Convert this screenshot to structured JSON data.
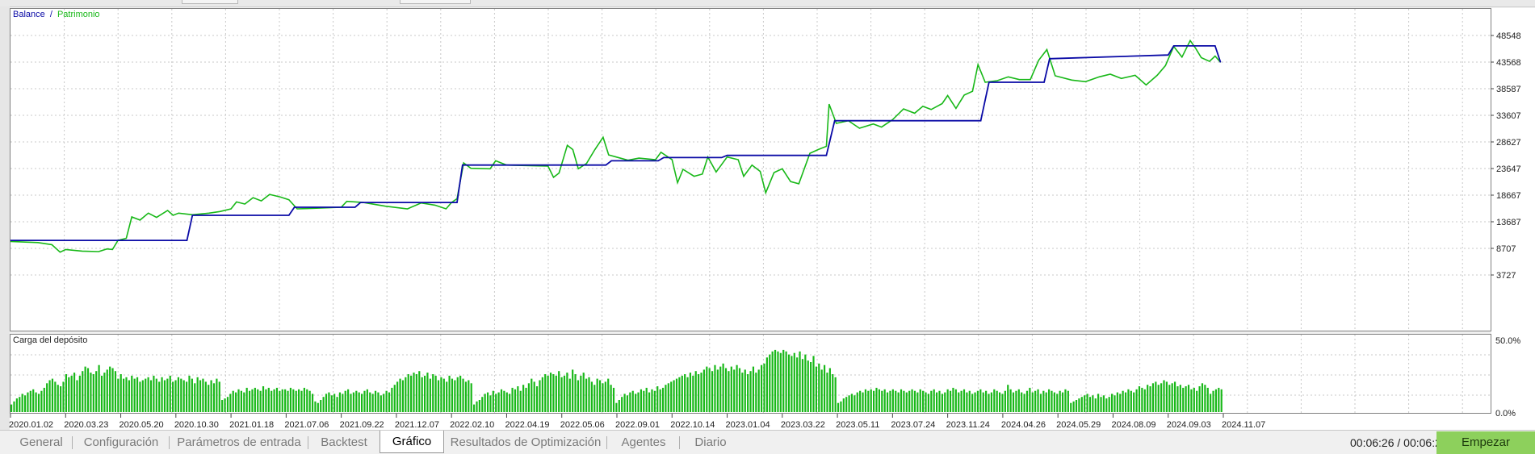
{
  "chart": {
    "legend": {
      "balance": "Balance",
      "separator": "/",
      "equity": "Patrimonio"
    },
    "subchart_label": "Carga del depósito",
    "y_ticks": [
      "48548",
      "43568",
      "38587",
      "33607",
      "28627",
      "23647",
      "18667",
      "13687",
      "8707",
      "3727"
    ],
    "sub_y_ticks": [
      "50.0%",
      "0.0%"
    ],
    "x_ticks": [
      "2020.01.02",
      "2020.03.23",
      "2020.05.20",
      "2020.10.30",
      "2021.01.18",
      "2021.07.06",
      "2021.09.22",
      "2021.12.07",
      "2022.02.10",
      "2022.04.19",
      "2022.05.06",
      "2022.09.01",
      "2022.10.14",
      "2023.01.04",
      "2023.03.22",
      "2023.05.11",
      "2023.07.24",
      "2023.11.24",
      "2024.04.26",
      "2024.05.29",
      "2024.08.09",
      "2024.09.03",
      "2024.11.07"
    ],
    "colors": {
      "balance": "#0a0aa6",
      "equity": "#18b818",
      "load": "#18b818",
      "grid": "#c8c8c8"
    }
  },
  "chart_data": {
    "type": "line",
    "xlabel": "",
    "ylabel": "",
    "ylim": [
      3727,
      50200
    ],
    "grid": true,
    "legend_placement": "top-left",
    "x_tick_index": [
      0,
      100,
      200,
      300,
      400,
      500,
      600,
      700,
      800,
      900,
      1000,
      1100,
      1200,
      1300,
      1400,
      1500,
      1600,
      1700,
      1800,
      1900,
      2000,
      2100,
      2200
    ],
    "series": [
      {
        "name": "Balance",
        "points": [
          [
            0,
            10200
          ],
          [
            320,
            10200
          ],
          [
            330,
            14900
          ],
          [
            505,
            14900
          ],
          [
            515,
            16400
          ],
          [
            625,
            16400
          ],
          [
            635,
            17300
          ],
          [
            810,
            17300
          ],
          [
            820,
            24300
          ],
          [
            1080,
            24300
          ],
          [
            1090,
            25100
          ],
          [
            1175,
            25100
          ],
          [
            1185,
            25700
          ],
          [
            1290,
            25700
          ],
          [
            1300,
            26100
          ],
          [
            1480,
            26100
          ],
          [
            1495,
            32600
          ],
          [
            1760,
            32600
          ],
          [
            1775,
            39800
          ],
          [
            1875,
            39800
          ],
          [
            1885,
            44200
          ],
          [
            2100,
            44900
          ],
          [
            2110,
            46600
          ],
          [
            2185,
            46600
          ],
          [
            2195,
            43500
          ]
        ]
      },
      {
        "name": "Patrimonio",
        "points": [
          [
            0,
            10000
          ],
          [
            50,
            9800
          ],
          [
            75,
            9400
          ],
          [
            90,
            8000
          ],
          [
            100,
            8500
          ],
          [
            130,
            8200
          ],
          [
            160,
            8100
          ],
          [
            175,
            8600
          ],
          [
            185,
            8500
          ],
          [
            195,
            10200
          ],
          [
            210,
            10600
          ],
          [
            220,
            14600
          ],
          [
            235,
            14000
          ],
          [
            250,
            15300
          ],
          [
            265,
            14500
          ],
          [
            285,
            15800
          ],
          [
            295,
            14900
          ],
          [
            305,
            15300
          ],
          [
            330,
            15000
          ],
          [
            360,
            15300
          ],
          [
            380,
            15600
          ],
          [
            400,
            16100
          ],
          [
            410,
            17400
          ],
          [
            425,
            17000
          ],
          [
            440,
            18200
          ],
          [
            455,
            17600
          ],
          [
            470,
            18800
          ],
          [
            490,
            18300
          ],
          [
            505,
            17800
          ],
          [
            520,
            16100
          ],
          [
            550,
            16200
          ],
          [
            600,
            16400
          ],
          [
            610,
            17500
          ],
          [
            640,
            17300
          ],
          [
            680,
            16600
          ],
          [
            720,
            16100
          ],
          [
            745,
            17200
          ],
          [
            770,
            16800
          ],
          [
            790,
            16100
          ],
          [
            800,
            17300
          ],
          [
            810,
            18000
          ],
          [
            822,
            24700
          ],
          [
            835,
            23700
          ],
          [
            870,
            23600
          ],
          [
            880,
            25100
          ],
          [
            900,
            24300
          ],
          [
            935,
            24200
          ],
          [
            975,
            24100
          ],
          [
            985,
            22000
          ],
          [
            995,
            22800
          ],
          [
            1010,
            28000
          ],
          [
            1020,
            27200
          ],
          [
            1030,
            23600
          ],
          [
            1045,
            24600
          ],
          [
            1060,
            27200
          ],
          [
            1075,
            29500
          ],
          [
            1085,
            26200
          ],
          [
            1120,
            25200
          ],
          [
            1140,
            25600
          ],
          [
            1170,
            25300
          ],
          [
            1180,
            26700
          ],
          [
            1200,
            25300
          ],
          [
            1210,
            21000
          ],
          [
            1220,
            23500
          ],
          [
            1240,
            22200
          ],
          [
            1255,
            22600
          ],
          [
            1265,
            25800
          ],
          [
            1280,
            23000
          ],
          [
            1300,
            25800
          ],
          [
            1320,
            25300
          ],
          [
            1330,
            22200
          ],
          [
            1345,
            24300
          ],
          [
            1360,
            23100
          ],
          [
            1370,
            19100
          ],
          [
            1385,
            22900
          ],
          [
            1400,
            23600
          ],
          [
            1415,
            21200
          ],
          [
            1430,
            20800
          ],
          [
            1450,
            26500
          ],
          [
            1465,
            27200
          ],
          [
            1480,
            27800
          ],
          [
            1485,
            35700
          ],
          [
            1498,
            32100
          ],
          [
            1520,
            32600
          ],
          [
            1540,
            31200
          ],
          [
            1565,
            32000
          ],
          [
            1580,
            31400
          ],
          [
            1600,
            32800
          ],
          [
            1620,
            34800
          ],
          [
            1640,
            34000
          ],
          [
            1655,
            35300
          ],
          [
            1670,
            34700
          ],
          [
            1690,
            35800
          ],
          [
            1700,
            37300
          ],
          [
            1715,
            34900
          ],
          [
            1730,
            37400
          ],
          [
            1745,
            38100
          ],
          [
            1755,
            43100
          ],
          [
            1768,
            39800
          ],
          [
            1790,
            40100
          ],
          [
            1810,
            40800
          ],
          [
            1830,
            40300
          ],
          [
            1850,
            40300
          ],
          [
            1865,
            43900
          ],
          [
            1880,
            45900
          ],
          [
            1895,
            41000
          ],
          [
            1925,
            40200
          ],
          [
            1950,
            39900
          ],
          [
            1975,
            40800
          ],
          [
            1995,
            41300
          ],
          [
            2015,
            40500
          ],
          [
            2040,
            41100
          ],
          [
            2060,
            39300
          ],
          [
            2080,
            41100
          ],
          [
            2095,
            42900
          ],
          [
            2110,
            46500
          ],
          [
            2125,
            44500
          ],
          [
            2140,
            47600
          ],
          [
            2150,
            46100
          ],
          [
            2160,
            44400
          ],
          [
            2175,
            43700
          ],
          [
            2185,
            44700
          ],
          [
            2195,
            43500
          ]
        ]
      }
    ],
    "subchart": {
      "type": "bar",
      "name": "Carga del depósito",
      "ylim": [
        0,
        50
      ],
      "values": [
        5,
        7,
        9,
        10,
        12,
        11,
        13,
        14,
        15,
        13,
        12,
        14,
        16,
        19,
        21,
        22,
        20,
        18,
        17,
        20,
        25,
        23,
        24,
        26,
        21,
        24,
        27,
        30,
        29,
        26,
        25,
        27,
        31,
        24,
        26,
        28,
        30,
        29,
        27,
        22,
        25,
        22,
        23,
        21,
        24,
        22,
        23,
        20,
        21,
        22,
        23,
        21,
        24,
        22,
        20,
        23,
        21,
        22,
        24,
        20,
        21,
        23,
        22,
        21,
        20,
        24,
        22,
        19,
        23,
        21,
        22,
        20,
        18,
        21,
        19,
        22,
        20,
        8,
        9,
        10,
        12,
        14,
        13,
        15,
        14,
        13,
        16,
        14,
        15,
        16,
        15,
        14,
        17,
        15,
        16,
        14,
        15,
        16,
        14,
        15,
        15,
        14,
        16,
        15,
        14,
        15,
        14,
        16,
        15,
        14,
        12,
        7,
        6,
        8,
        10,
        12,
        13,
        11,
        12,
        10,
        13,
        12,
        14,
        15,
        12,
        13,
        14,
        13,
        12,
        14,
        15,
        13,
        12,
        14,
        13,
        11,
        12,
        14,
        13,
        16,
        18,
        20,
        22,
        21,
        23,
        25,
        24,
        26,
        25,
        27,
        23,
        24,
        26,
        22,
        25,
        24,
        21,
        23,
        22,
        20,
        24,
        22,
        21,
        23,
        24,
        22,
        20,
        21,
        19,
        5,
        7,
        8,
        10,
        12,
        13,
        11,
        14,
        12,
        13,
        15,
        14,
        13,
        12,
        16,
        15,
        17,
        14,
        18,
        16,
        19,
        22,
        20,
        17,
        21,
        23,
        25,
        24,
        26,
        25,
        24,
        27,
        23,
        24,
        26,
        22,
        28,
        25,
        21,
        24,
        26,
        22,
        23,
        20,
        18,
        22,
        21,
        19,
        20,
        22,
        18,
        16,
        6,
        8,
        10,
        12,
        11,
        13,
        14,
        12,
        13,
        15,
        14,
        16,
        13,
        15,
        14,
        17,
        15,
        16,
        18,
        19,
        20,
        21,
        22,
        23,
        24,
        25,
        23,
        26,
        24,
        27,
        25,
        26,
        28,
        30,
        29,
        27,
        31,
        28,
        30,
        32,
        29,
        27,
        30,
        28,
        31,
        29,
        26,
        28,
        25,
        27,
        30,
        26,
        28,
        31,
        32,
        36,
        38,
        40,
        41,
        40,
        39,
        41,
        40,
        38,
        37,
        39,
        36,
        40,
        35,
        38,
        34,
        33,
        37,
        30,
        32,
        28,
        31,
        26,
        29,
        25,
        23,
        6,
        7,
        9,
        10,
        11,
        12,
        11,
        13,
        14,
        13,
        15,
        14,
        15,
        14,
        16,
        15,
        14,
        15,
        13,
        14,
        15,
        14,
        13,
        15,
        14,
        13,
        14,
        15,
        14,
        13,
        15,
        14,
        13,
        12,
        14,
        15,
        13,
        14,
        12,
        13,
        15,
        14,
        16,
        15,
        13,
        14,
        15,
        13,
        14,
        12,
        13,
        14,
        15,
        13,
        14,
        12,
        13,
        15,
        14,
        13,
        12,
        14,
        18,
        15,
        13,
        14,
        15,
        13,
        12,
        14,
        16,
        13,
        14,
        15,
        12,
        14,
        13,
        15,
        14,
        13,
        12,
        14,
        13,
        15,
        14,
        6,
        7,
        8,
        9,
        10,
        11,
        12,
        10,
        11,
        9,
        12,
        10,
        11,
        9,
        10,
        12,
        11,
        13,
        12,
        14,
        13,
        15,
        14,
        13,
        15,
        17,
        16,
        15,
        18,
        17,
        19,
        20,
        18,
        19,
        21,
        20,
        18,
        19,
        20,
        17,
        18,
        16,
        17,
        18,
        15,
        16,
        14,
        17,
        19,
        18,
        16,
        12,
        14,
        15,
        16,
        15
      ]
    }
  }
}
